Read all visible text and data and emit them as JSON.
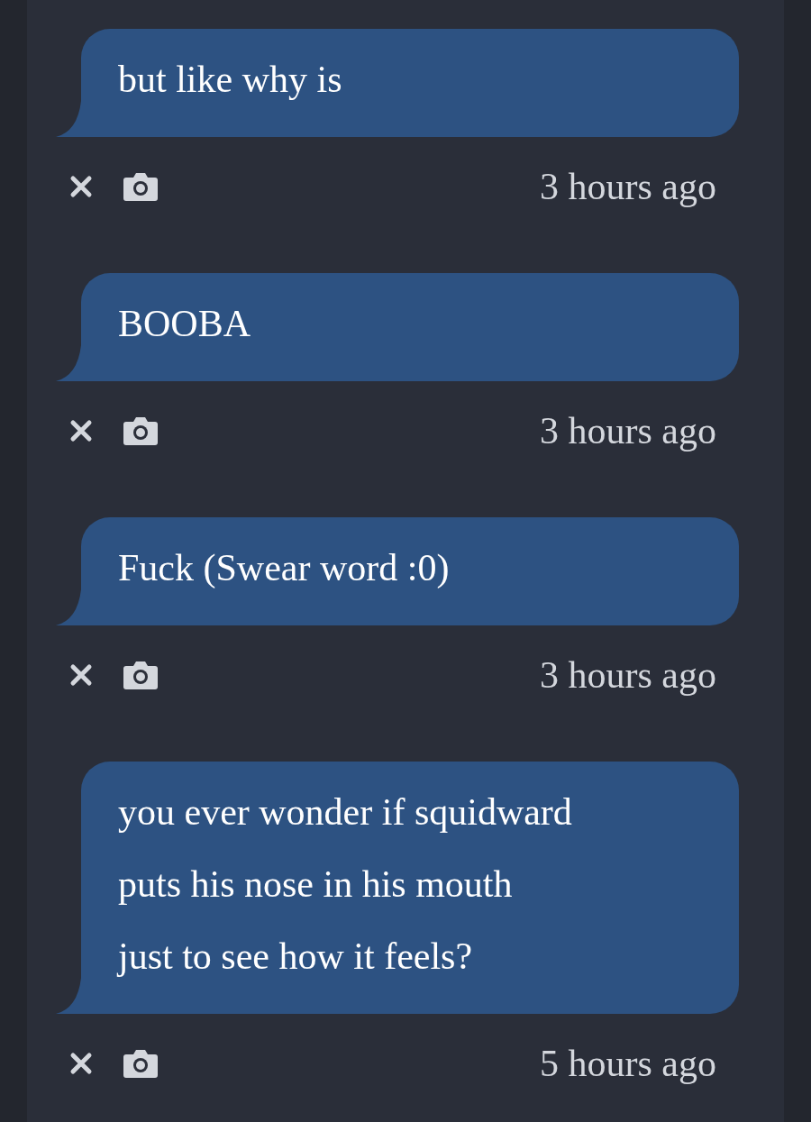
{
  "messages": [
    {
      "lines": [
        "but like why is"
      ],
      "time": "3 hours ago"
    },
    {
      "lines": [
        "BOOBA"
      ],
      "time": "3 hours ago"
    },
    {
      "lines": [
        "Fuck (Swear word :0)"
      ],
      "time": "3 hours ago"
    },
    {
      "lines": [
        "you ever wonder if squidward",
        "puts his nose in his mouth",
        "just to see how it feels?"
      ],
      "time": "5 hours ago"
    }
  ]
}
